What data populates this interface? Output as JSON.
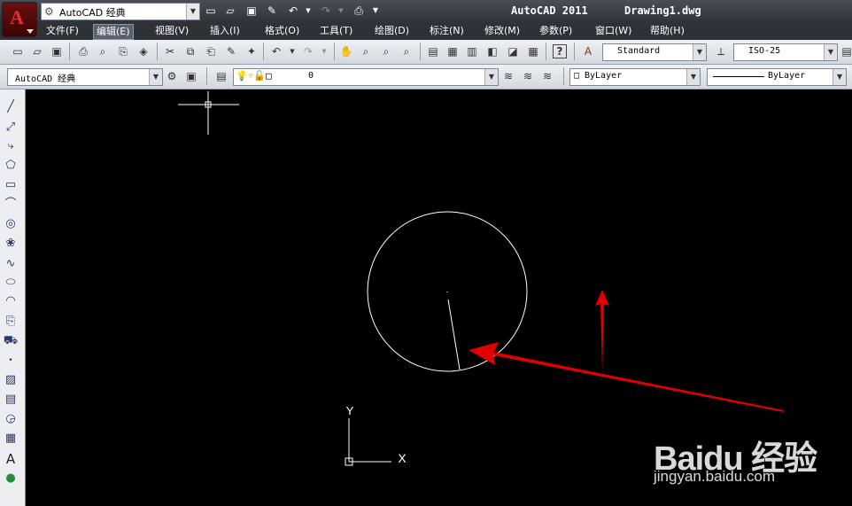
{
  "window": {
    "app_title": "AutoCAD 2011",
    "file_name": "Drawing1.dwg",
    "workspace": "AutoCAD 经典"
  },
  "menu": {
    "items": [
      "文件(F)",
      "编辑(E)",
      "视图(V)",
      "插入(I)",
      "格式(O)",
      "工具(T)",
      "绘图(D)",
      "标注(N)",
      "修改(M)",
      "参数(P)",
      "窗口(W)",
      "帮助(H)"
    ],
    "active_index": 1
  },
  "toolbar": {
    "text_style": "Standard",
    "dim_style": "ISO-25",
    "workspace_combo": "AutoCAD 经典",
    "layer": "0",
    "color": "ByLayer",
    "linetype": "ByLayer"
  },
  "icons": {
    "app_logo": "autocad-logo-icon",
    "quick_access": [
      "new-icon",
      "open-icon",
      "save-icon",
      "edit-icon",
      "undo-icon",
      "redo-icon",
      "print-icon"
    ],
    "palette": [
      "line-icon",
      "construction-line-icon",
      "polyline-icon",
      "polygon-icon",
      "rectangle-icon",
      "arc-icon",
      "circle-icon",
      "revision-cloud-icon",
      "spline-icon",
      "ellipse-icon",
      "ellipse-arc-icon",
      "insert-block-icon",
      "make-block-icon",
      "point-icon",
      "hatch-icon",
      "gradient-icon",
      "region-icon",
      "table-icon",
      "text-icon",
      "add-selected-icon"
    ]
  },
  "canvas": {
    "ucs_x_label": "X",
    "ucs_y_label": "Y",
    "background": "#000000",
    "annotation_color": "#ff0000"
  },
  "watermark": {
    "brand": "Baidu 经验",
    "url": "jingyan.baidu.com"
  }
}
